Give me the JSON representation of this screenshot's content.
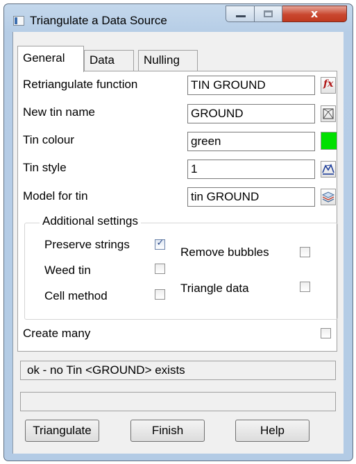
{
  "window": {
    "title": "Triangulate a Data Source",
    "close_glyph": "x"
  },
  "tabs": [
    {
      "label": "General",
      "active": true
    },
    {
      "label": "Data",
      "active": false
    },
    {
      "label": "Nulling",
      "active": false
    }
  ],
  "fields": {
    "retriangulate_function": {
      "label": "Retriangulate function",
      "value": "TIN GROUND",
      "icon": "function-icon"
    },
    "new_tin_name": {
      "label": "New tin name",
      "value": "GROUND",
      "icon": "tin-select-icon"
    },
    "tin_colour": {
      "label": "Tin colour",
      "value": "green",
      "swatch_color": "#00e000"
    },
    "tin_style": {
      "label": "Tin style",
      "value": "1",
      "icon": "tin-style-icon"
    },
    "model_for_tin": {
      "label": "Model for tin",
      "value": "tin GROUND",
      "icon": "model-layers-icon"
    }
  },
  "additional": {
    "title": "Additional settings",
    "preserve_strings": {
      "label": "Preserve strings",
      "checked": true
    },
    "weed_tin": {
      "label": "Weed tin",
      "checked": false
    },
    "cell_method": {
      "label": "Cell method",
      "checked": false
    },
    "remove_bubbles": {
      "label": "Remove bubbles",
      "checked": false
    },
    "triangle_data": {
      "label": "Triangle data",
      "checked": false
    }
  },
  "create_many": {
    "label": "Create many",
    "checked": false
  },
  "status": {
    "message": "ok - no Tin <GROUND> exists",
    "secondary": ""
  },
  "buttons": {
    "triangulate": "Triangulate",
    "finish": "Finish",
    "help": "Help"
  },
  "colors": {
    "window_frame": "#b6cde6",
    "close_button": "#c9472f",
    "client_bg": "#f0f0f0"
  }
}
